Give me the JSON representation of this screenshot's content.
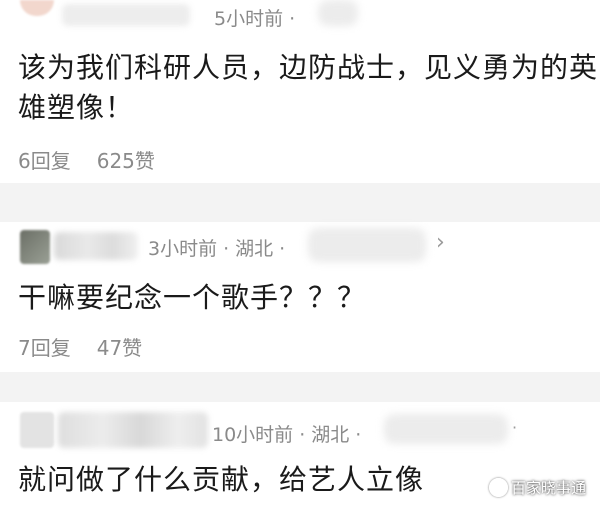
{
  "comments": [
    {
      "time": "5小时前",
      "location": "",
      "text_line1": "该为我们科研人员，边防战士，见义勇为的英",
      "text_line2": "雄塑像！",
      "replies": "6回复",
      "likes": "625赞"
    },
    {
      "time": "3小时前",
      "location": "湖北",
      "text_line1": "干嘛要纪念一个歌手？？？",
      "text_line2": "",
      "replies": "7回复",
      "likes": "47赞"
    },
    {
      "time": "10小时前",
      "location": "湖北",
      "text_line1": "就问做了什么贡献，给艺人立像",
      "text_line2": "",
      "replies": "",
      "likes": ""
    }
  ],
  "separator_dot": "·",
  "chevron": "›",
  "watermark": "百家晓事通",
  "icons": {
    "avatar": "avatar-icon",
    "chevron": "chevron-right-icon",
    "watermark": "brand-logo-icon"
  },
  "colors": {
    "meta_gray": "#8a8a8a",
    "text": "#1a1a1a",
    "separator": "#f3f3f3"
  }
}
